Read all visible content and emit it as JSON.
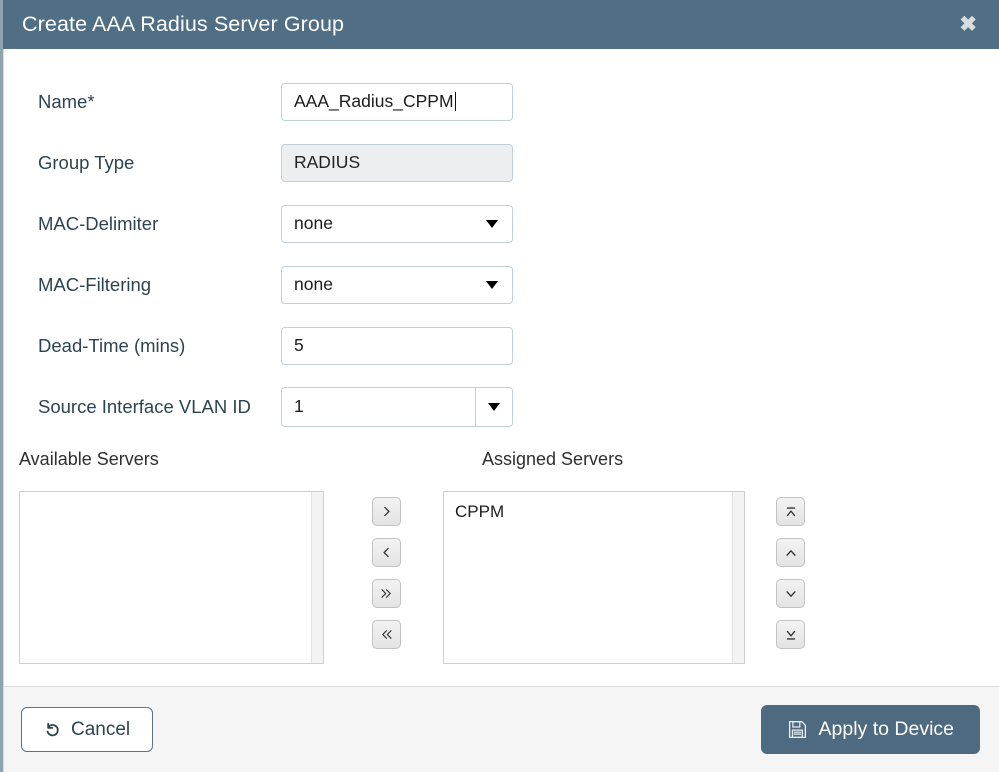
{
  "dialog": {
    "title": "Create AAA Radius Server Group",
    "close_icon": "close-x-icon"
  },
  "form": {
    "rows": [
      {
        "label": "Name*",
        "value": "AAA_Radius_CPPM",
        "type": "text"
      },
      {
        "label": "Group Type",
        "value": "RADIUS",
        "type": "text-disabled"
      },
      {
        "label": "MAC-Delimiter",
        "value": "none",
        "type": "select"
      },
      {
        "label": "MAC-Filtering",
        "value": "none",
        "type": "select"
      },
      {
        "label": "Dead-Time (mins)",
        "value": "5",
        "type": "text"
      },
      {
        "label": "Source Interface VLAN ID",
        "value": "1",
        "type": "combo"
      }
    ]
  },
  "dual_list": {
    "available_header": "Available Servers",
    "assigned_header": "Assigned Servers",
    "available_items": [],
    "assigned_items": [
      "CPPM"
    ],
    "transfer_buttons": [
      {
        "name": "move-right-button",
        "icon": "chevron-right-icon"
      },
      {
        "name": "move-left-button",
        "icon": "chevron-left-icon"
      },
      {
        "name": "move-all-right-button",
        "icon": "double-chevron-right-icon"
      },
      {
        "name": "move-all-left-button",
        "icon": "double-chevron-left-icon"
      }
    ],
    "reorder_buttons": [
      {
        "name": "move-to-top-button",
        "icon": "chevron-up-bar-icon"
      },
      {
        "name": "move-up-button",
        "icon": "chevron-up-icon"
      },
      {
        "name": "move-down-button",
        "icon": "chevron-down-icon"
      },
      {
        "name": "move-to-bottom-button",
        "icon": "chevron-down-bar-icon"
      }
    ]
  },
  "footer": {
    "cancel_label": "Cancel",
    "cancel_icon": "undo-arrow-icon",
    "apply_label": "Apply to Device",
    "apply_icon": "save-floppy-icon"
  },
  "colors": {
    "header_bg": "#506f84",
    "apply_bg": "#4e6a80",
    "label_text": "#2d4450",
    "field_border": "#bfd0da",
    "disabled_bg": "#eceeef",
    "footer_bg": "#f5f5f5"
  }
}
